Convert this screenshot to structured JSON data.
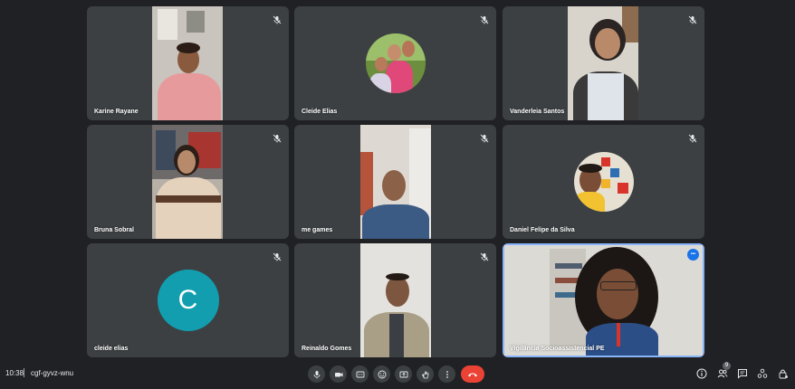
{
  "meeting": {
    "time": "10:38",
    "separator": "|",
    "code": "cgf-gyvz-wnu"
  },
  "participants": [
    {
      "name": "Karine Rayane",
      "muted": true
    },
    {
      "name": "Cleide Elias",
      "muted": true
    },
    {
      "name": "Vanderleia Santos",
      "muted": true
    },
    {
      "name": "Bruna Sobral",
      "muted": true
    },
    {
      "name": "me games",
      "muted": true
    },
    {
      "name": "Daniel Felipe da Silva",
      "muted": true
    },
    {
      "name": "cleide elias",
      "muted": true,
      "avatar_letter": "C"
    },
    {
      "name": "Reinaldo Gomes",
      "muted": true
    },
    {
      "name": "Vigilância Socioassistencial PE",
      "muted": false,
      "speaking": true
    }
  ],
  "people_count": "9",
  "more_options_glyph": "•••",
  "colors": {
    "background": "#202124",
    "tile": "#3c4043",
    "end_call": "#ea4335",
    "active_border": "#8ab4f8",
    "avatar_teal": "#129eaf"
  }
}
